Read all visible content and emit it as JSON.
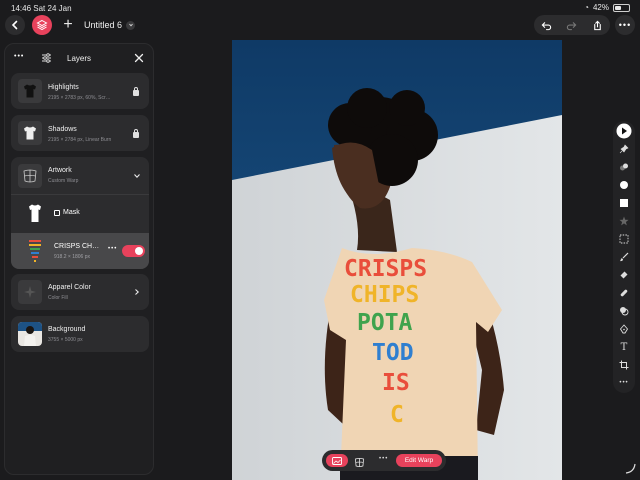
{
  "status": {
    "time": "14:46",
    "date": "Sat 24 Jan",
    "battery": "42%"
  },
  "header": {
    "doc_title": "Untitled 6"
  },
  "layers_panel": {
    "title": "Layers",
    "layers": [
      {
        "name": "Highlights",
        "sub": "2195 × 2783 px, 60%, Scr…"
      },
      {
        "name": "Shadows",
        "sub": "2195 × 2784 px, Linear Burn"
      },
      {
        "name": "Artwork",
        "sub": "Custom Warp"
      },
      {
        "name": "Mask"
      },
      {
        "name": "CRISPS CH…",
        "sub": "918.2 × 1806 px"
      },
      {
        "name": "Apparel Color",
        "sub": "Color Fill"
      },
      {
        "name": "Background",
        "sub": "3755 × 5000 px"
      }
    ]
  },
  "artwork_text": [
    "CRISPS",
    "CHIPS",
    "POTA",
    "TOD",
    "IS",
    "C"
  ],
  "bottom_bar": {
    "edit_label": "Edit Warp"
  },
  "colors": {
    "accent": "#e8425c",
    "sky": "#16456f",
    "wall": "#d7dbde",
    "shirt": "#f0d5b4"
  }
}
